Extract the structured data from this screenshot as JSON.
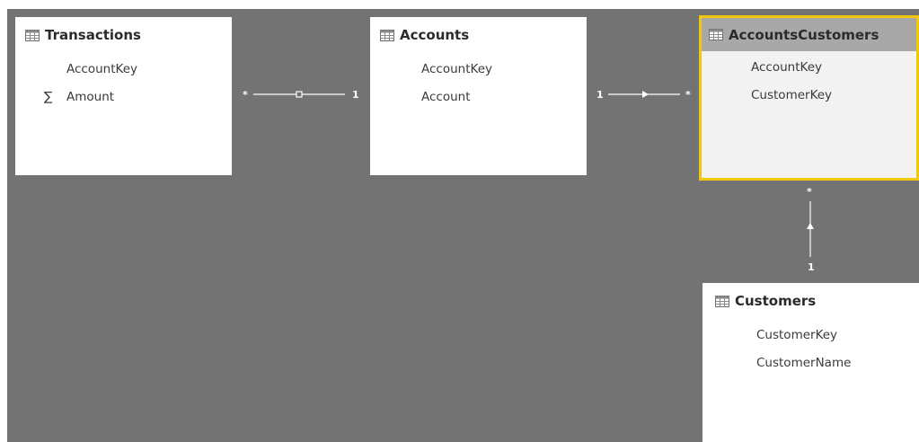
{
  "tables": [
    {
      "name": "Transactions",
      "icon": "table-icon",
      "fields": [
        {
          "name": "AccountKey",
          "icon": ""
        },
        {
          "name": "Amount",
          "icon": "sigma-icon",
          "glyph": "∑"
        }
      ]
    },
    {
      "name": "Accounts",
      "icon": "table-icon",
      "fields": [
        {
          "name": "AccountKey"
        },
        {
          "name": "Account"
        }
      ]
    },
    {
      "name": "AccountsCustomers",
      "icon": "table-icon",
      "selected": true,
      "fields": [
        {
          "name": "AccountKey"
        },
        {
          "name": "CustomerKey"
        }
      ]
    },
    {
      "name": "Customers",
      "icon": "table-icon",
      "fields": [
        {
          "name": "CustomerKey"
        },
        {
          "name": "CustomerName"
        }
      ]
    }
  ],
  "relationships": [
    {
      "from": "Transactions",
      "to": "Accounts",
      "from_cardinality": "*",
      "to_cardinality": "1"
    },
    {
      "from": "Accounts",
      "to": "AccountsCustomers",
      "from_cardinality": "1",
      "to_cardinality": "*"
    },
    {
      "from": "AccountsCustomers",
      "to": "Customers",
      "from_cardinality": "*",
      "to_cardinality": "1"
    }
  ],
  "colors": {
    "canvas": "#737373",
    "selection_border": "#f2c80f",
    "selected_header": "#a8a8a8",
    "card": "#ffffff"
  }
}
